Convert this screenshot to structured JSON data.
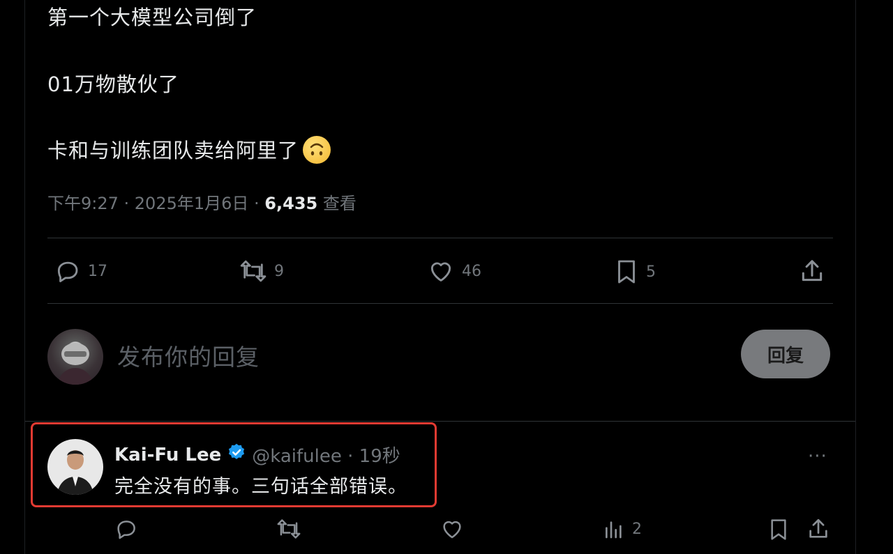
{
  "tweet": {
    "lines": [
      "第一个大模型公司倒了",
      "01万物散伙了",
      "卡和与训练团队卖给阿里了"
    ],
    "emoji_icon": "upside-down-face-icon",
    "time": "下午9:27 · 2025年1月6日 · ",
    "views_count": "6,435",
    "views_label": " 查看",
    "actions": {
      "replies": "17",
      "retweets": "9",
      "likes": "46",
      "bookmarks": "5"
    }
  },
  "compose": {
    "placeholder": "发布你的回复",
    "button_label": "回复"
  },
  "reply": {
    "name": "Kai-Fu Lee",
    "handle": "@kaifulee · 19秒",
    "text": "完全没有的事。三句话全部错误。",
    "more_label": "···",
    "views": "2"
  },
  "colors": {
    "background": "#000000",
    "text": "#e7e9ea",
    "muted": "#71767b",
    "verified": "#1d9bf0",
    "highlight": "#e23a32"
  }
}
